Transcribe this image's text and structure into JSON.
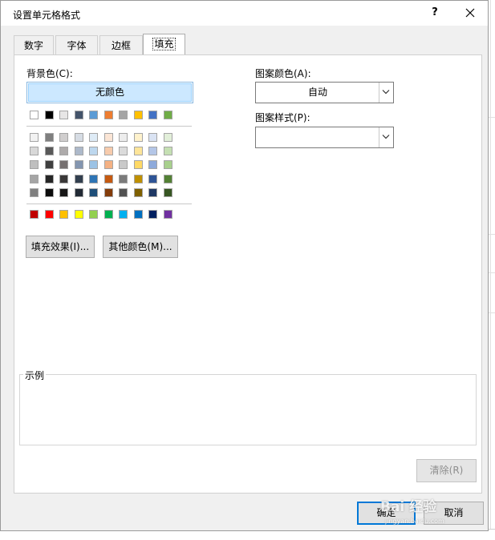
{
  "window": {
    "title": "设置单元格格式",
    "help": "?",
    "close": "✕"
  },
  "tabs": [
    {
      "label": "数字"
    },
    {
      "label": "字体"
    },
    {
      "label": "边框"
    },
    {
      "label": "填充",
      "active": true
    }
  ],
  "background_color": {
    "label": "背景色(C):",
    "no_color_label": "无颜色",
    "theme_top": [
      "#ffffff",
      "#000000",
      "#e7e6e6",
      "#44546a",
      "#5b9bd5",
      "#ed7d31",
      "#a5a5a5",
      "#ffc000",
      "#4472c4",
      "#70ad47"
    ],
    "theme_shades": [
      [
        "#f2f2f2",
        "#7f7f7f",
        "#d0cece",
        "#d6dce4",
        "#deebf6",
        "#fbe5d5",
        "#ededed",
        "#fff2cc",
        "#dae3f3",
        "#e2efd9"
      ],
      [
        "#d8d8d8",
        "#595959",
        "#aeabab",
        "#adb9ca",
        "#bdd7ee",
        "#f7cbac",
        "#dbdbdb",
        "#fee599",
        "#b4c6e7",
        "#c5e0b3"
      ],
      [
        "#bfbfbf",
        "#3f3f3f",
        "#757070",
        "#8496b0",
        "#9cc3e5",
        "#f4b183",
        "#c9c9c9",
        "#ffd965",
        "#8eaadb",
        "#a8d08d"
      ],
      [
        "#a5a5a5",
        "#262626",
        "#3a3838",
        "#323f4f",
        "#2e75b5",
        "#c55a11",
        "#7b7b7b",
        "#bf9000",
        "#2f5496",
        "#538135"
      ],
      [
        "#7f7f7f",
        "#0c0c0c",
        "#171616",
        "#222a35",
        "#1e4e79",
        "#833c0b",
        "#525252",
        "#7f6000",
        "#1f3864",
        "#375623"
      ]
    ],
    "standard": [
      "#c00000",
      "#ff0000",
      "#ffc000",
      "#ffff00",
      "#92d050",
      "#00b050",
      "#00b0f0",
      "#0070c0",
      "#002060",
      "#7030a0"
    ]
  },
  "buttons": {
    "fill_effects": "填充效果(I)...",
    "more_colors": "其他颜色(M)...",
    "clear": "清除(R)",
    "ok": "确定",
    "cancel": "取消"
  },
  "pattern_color": {
    "label": "图案颜色(A):",
    "value": "自动"
  },
  "pattern_style": {
    "label": "图案样式(P):",
    "value": ""
  },
  "sample": {
    "label": "示例"
  },
  "watermark": {
    "text": "Bai 经验",
    "sub": "jingyan.baidu.com"
  }
}
